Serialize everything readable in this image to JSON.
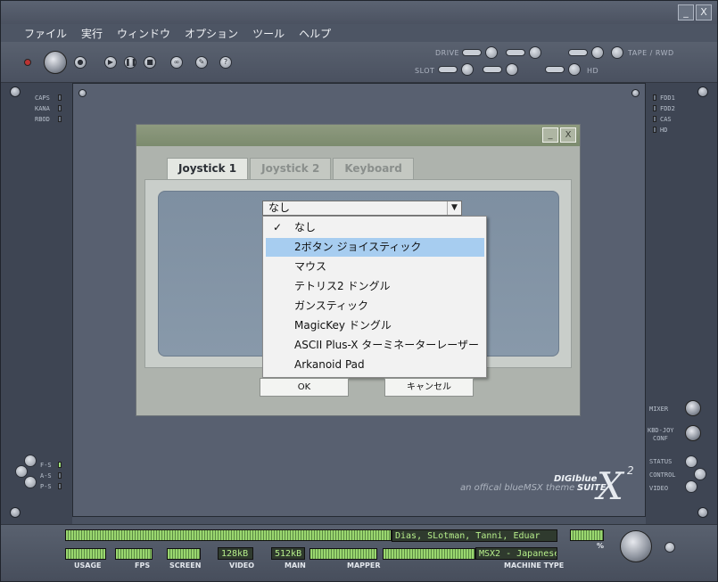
{
  "menu": [
    "ファイル",
    "実行",
    "ウィンドウ",
    "オプション",
    "ツール",
    "ヘルプ"
  ],
  "toolbar": {
    "drive_label": "DRIVE",
    "slot_label": "SLOT",
    "tape_label": "TAPE / RWD",
    "hd_label": "HD"
  },
  "left_rail": [
    "CAPS",
    "KANA",
    "RBOD"
  ],
  "right_rail": [
    "FDD1",
    "FDD2",
    "CAS",
    "HD"
  ],
  "left_bottom_rail": [
    "F-S",
    "A-S",
    "P-S"
  ],
  "right_bottom_rail": {
    "mixer": "MIXER",
    "kbd_joy": "KBD-JOY",
    "conf": "CONF",
    "status": "STATUS",
    "control": "CONTROL",
    "video": "VIDEO"
  },
  "dialog": {
    "tabs": [
      "Joystick 1",
      "Joystick 2",
      "Keyboard"
    ],
    "active_tab": 0,
    "select_value": "なし",
    "options": [
      "なし",
      "2ボタン ジョイスティック",
      "マウス",
      "テトリス2 ドングル",
      "ガンスティック",
      "MagicKey ドングル",
      "ASCII Plus-X ターミネーターレーザー",
      "Arkanoid Pad"
    ],
    "selected_index": 0,
    "highlight_index": 1,
    "ok_label": "OK",
    "cancel_label": "キャンセル"
  },
  "brand": {
    "line1": "DIGIblue",
    "line2": "an offical blueMSX theme",
    "line3": "SUITE",
    "mark": "X",
    "mark_sup": "2"
  },
  "status": {
    "credits": "Dias, SLotman, Tanni, Eduar",
    "video": "128kB",
    "main": "512kB",
    "machine": "MSX2 - Japanese",
    "labels": [
      "USAGE",
      "FPS",
      "SCREEN",
      "VIDEO",
      "MAIN",
      "MAPPER",
      "MACHINE TYPE"
    ],
    "percent_label": "%"
  },
  "window_buttons": [
    "_",
    "X"
  ]
}
